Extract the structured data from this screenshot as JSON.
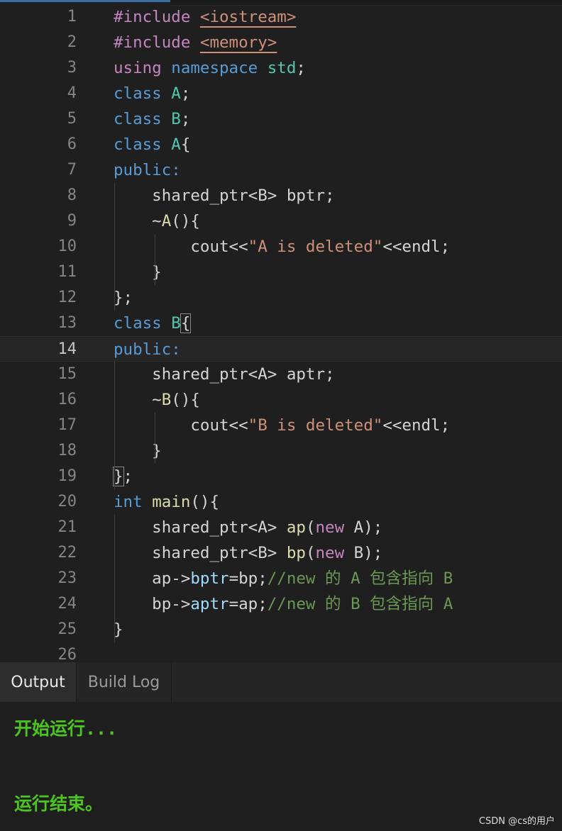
{
  "editor": {
    "lines": [
      {
        "n": "1",
        "tokens": [
          {
            "t": "#include",
            "c": "kw-pre"
          },
          {
            "t": " ",
            "c": ""
          },
          {
            "t": "<iostream>",
            "c": "inc"
          }
        ]
      },
      {
        "n": "2",
        "tokens": [
          {
            "t": "#include",
            "c": "kw-pre"
          },
          {
            "t": " ",
            "c": ""
          },
          {
            "t": "<memory>",
            "c": "inc"
          }
        ]
      },
      {
        "n": "3",
        "tokens": [
          {
            "t": "using",
            "c": "kw-pre"
          },
          {
            "t": " ",
            "c": ""
          },
          {
            "t": "namespace",
            "c": "kw"
          },
          {
            "t": " ",
            "c": ""
          },
          {
            "t": "std",
            "c": "ty"
          },
          {
            "t": ";",
            "c": ""
          }
        ]
      },
      {
        "n": "4",
        "tokens": [
          {
            "t": "class",
            "c": "kw"
          },
          {
            "t": " ",
            "c": ""
          },
          {
            "t": "A",
            "c": "ty"
          },
          {
            "t": ";",
            "c": ""
          }
        ]
      },
      {
        "n": "5",
        "tokens": [
          {
            "t": "class",
            "c": "kw"
          },
          {
            "t": " ",
            "c": ""
          },
          {
            "t": "B",
            "c": "ty"
          },
          {
            "t": ";",
            "c": ""
          }
        ]
      },
      {
        "n": "6",
        "tokens": [
          {
            "t": "class",
            "c": "kw"
          },
          {
            "t": " ",
            "c": ""
          },
          {
            "t": "A",
            "c": "ty"
          },
          {
            "t": "{",
            "c": ""
          }
        ]
      },
      {
        "n": "7",
        "tokens": [
          {
            "t": "public:",
            "c": "kw"
          }
        ]
      },
      {
        "n": "8",
        "tokens": [
          {
            "t": "    shared_ptr<B> bptr;",
            "c": ""
          }
        ]
      },
      {
        "n": "9",
        "tokens": [
          {
            "t": "    ~",
            "c": ""
          },
          {
            "t": "A",
            "c": "fn"
          },
          {
            "t": "(){",
            "c": ""
          }
        ]
      },
      {
        "n": "10",
        "tokens": [
          {
            "t": "        cout<<",
            "c": ""
          },
          {
            "t": "\"A is deleted\"",
            "c": "str"
          },
          {
            "t": "<<endl;",
            "c": ""
          }
        ]
      },
      {
        "n": "11",
        "tokens": [
          {
            "t": "    }",
            "c": ""
          }
        ]
      },
      {
        "n": "12",
        "tokens": [
          {
            "t": "};",
            "c": ""
          }
        ]
      },
      {
        "n": "13",
        "tokens": [
          {
            "t": "class",
            "c": "kw"
          },
          {
            "t": " ",
            "c": ""
          },
          {
            "t": "B",
            "c": "ty"
          },
          {
            "t": "{",
            "c": "br-match"
          }
        ]
      },
      {
        "n": "14",
        "tokens": [
          {
            "t": "public:",
            "c": "kw"
          }
        ],
        "current": true
      },
      {
        "n": "15",
        "tokens": [
          {
            "t": "    shared_ptr<A> aptr;",
            "c": ""
          }
        ]
      },
      {
        "n": "16",
        "tokens": [
          {
            "t": "    ~",
            "c": ""
          },
          {
            "t": "B",
            "c": "fn"
          },
          {
            "t": "(){",
            "c": ""
          }
        ]
      },
      {
        "n": "17",
        "tokens": [
          {
            "t": "        cout<<",
            "c": ""
          },
          {
            "t": "\"B is deleted\"",
            "c": "str"
          },
          {
            "t": "<<endl;",
            "c": ""
          }
        ]
      },
      {
        "n": "18",
        "tokens": [
          {
            "t": "    }",
            "c": ""
          }
        ]
      },
      {
        "n": "19",
        "tokens": [
          {
            "t": "}",
            "c": "br-match"
          },
          {
            "t": ";",
            "c": ""
          }
        ]
      },
      {
        "n": "20",
        "tokens": [
          {
            "t": "int",
            "c": "kw"
          },
          {
            "t": " ",
            "c": ""
          },
          {
            "t": "main",
            "c": "fn"
          },
          {
            "t": "(){",
            "c": ""
          }
        ]
      },
      {
        "n": "21",
        "tokens": [
          {
            "t": "    shared_ptr<A> ",
            "c": ""
          },
          {
            "t": "ap",
            "c": "fn"
          },
          {
            "t": "(",
            "c": ""
          },
          {
            "t": "new",
            "c": "kw-pre"
          },
          {
            "t": " A);",
            "c": ""
          }
        ]
      },
      {
        "n": "22",
        "tokens": [
          {
            "t": "    shared_ptr<B> ",
            "c": ""
          },
          {
            "t": "bp",
            "c": "fn"
          },
          {
            "t": "(",
            "c": ""
          },
          {
            "t": "new",
            "c": "kw-pre"
          },
          {
            "t": " B);",
            "c": ""
          }
        ]
      },
      {
        "n": "23",
        "tokens": [
          {
            "t": "    ap->",
            "c": ""
          },
          {
            "t": "bptr",
            "c": "var"
          },
          {
            "t": "=bp;",
            "c": ""
          },
          {
            "t": "//new 的 A 包含指向 B",
            "c": "cm"
          }
        ]
      },
      {
        "n": "24",
        "tokens": [
          {
            "t": "    bp->",
            "c": ""
          },
          {
            "t": "aptr",
            "c": "var"
          },
          {
            "t": "=ap;",
            "c": ""
          },
          {
            "t": "//new 的 B 包含指向 A",
            "c": "cm"
          }
        ]
      },
      {
        "n": "25",
        "tokens": [
          {
            "t": "}",
            "c": ""
          }
        ]
      },
      {
        "n": "26",
        "tokens": []
      }
    ]
  },
  "panel": {
    "tabs": [
      {
        "label": "Output",
        "active": true
      },
      {
        "label": "Build Log",
        "active": false
      }
    ],
    "output_lines": [
      "开始运行...",
      "运行结束。"
    ]
  },
  "watermark": "CSDN @cs的用户",
  "colors": {
    "keyword": "#569cd6",
    "preprocessor": "#c586c0",
    "type": "#4ec9b0",
    "string": "#ce9178",
    "function": "#dcdcaa",
    "comment": "#6a9955",
    "output_text": "#4dc520"
  }
}
